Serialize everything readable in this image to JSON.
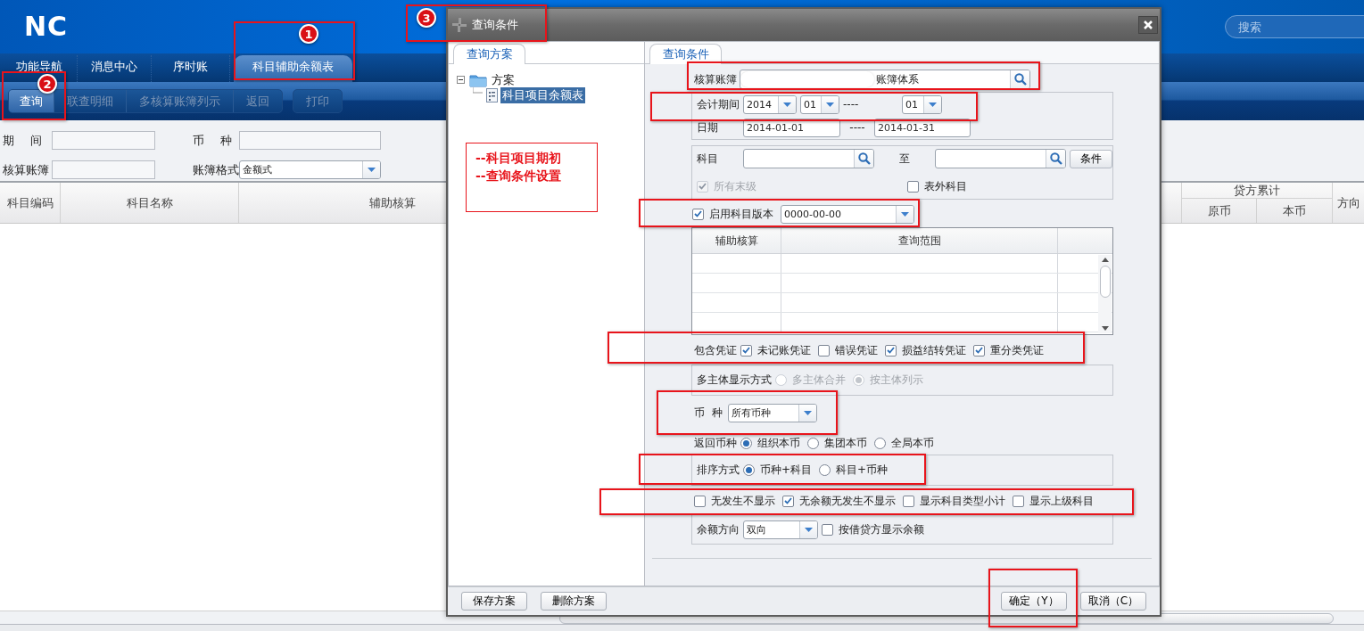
{
  "app": {
    "logo": "NC",
    "search": {
      "placeholder": "搜索"
    },
    "tabs": [
      {
        "label": "功能导航",
        "selected": false
      },
      {
        "label": "消息中心",
        "selected": false
      },
      {
        "label": "序时账",
        "selected": false
      },
      {
        "label": "科目辅助余额表",
        "selected": true
      }
    ],
    "toolbar": [
      {
        "buttons": [
          {
            "label": "查询",
            "disabled": false
          },
          {
            "label": "联查明细",
            "disabled": true
          },
          {
            "label": "多核算账簿列示",
            "disabled": true
          },
          {
            "label": "返回",
            "disabled": true
          }
        ]
      },
      {
        "buttons": [
          {
            "label": "打印",
            "disabled": true
          }
        ]
      }
    ],
    "filters": [
      {
        "label": "期 间",
        "kind": "text"
      },
      {
        "label": "币 种",
        "kind": "text"
      },
      {
        "label": "核算账簿",
        "kind": "text"
      },
      {
        "label": "账簿格式",
        "kind": "combo",
        "value": "金额式"
      }
    ],
    "table": {
      "columns": [
        "科目编码",
        "科目名称",
        "辅助核算"
      ],
      "right_columns": [
        {
          "label": "贷方累计",
          "children": [
            "原币",
            "本币"
          ]
        },
        {
          "label": "方向"
        }
      ]
    }
  },
  "dialog": {
    "title": "查询条件",
    "left": {
      "tab": "查询方案",
      "tree": [
        {
          "label": "方案",
          "expanded": true,
          "children": [
            {
              "label": "科目项目余额表",
              "selected": true
            }
          ]
        }
      ]
    },
    "right": {
      "tab": "查询条件",
      "form": [
        {
          "kind": "row",
          "items": [
            {
              "kind": "label",
              "text": "核算账簿"
            },
            {
              "kind": "lookup",
              "value": "账簿体系",
              "redacted": true
            }
          ]
        },
        {
          "kind": "group",
          "rows": [
            {
              "kind": "row",
              "items": [
                {
                  "kind": "label",
                  "text": "会计期间"
                },
                {
                  "kind": "combo",
                  "value": "2014"
                },
                {
                  "kind": "combo",
                  "value": "01"
                },
                {
                  "kind": "sep",
                  "text": "----"
                },
                {
                  "kind": "combo",
                  "value": "01"
                }
              ]
            },
            {
              "kind": "row",
              "items": [
                {
                  "kind": "label",
                  "text": "日期"
                },
                {
                  "kind": "text",
                  "value": "2014-01-01"
                },
                {
                  "kind": "sep",
                  "text": "----"
                },
                {
                  "kind": "text",
                  "value": "2014-01-31"
                }
              ]
            }
          ]
        },
        {
          "kind": "group",
          "rows": [
            {
              "kind": "row",
              "items": [
                {
                  "kind": "label",
                  "text": "科目"
                },
                {
                  "kind": "lookup"
                },
                {
                  "kind": "sep",
                  "text": "至"
                },
                {
                  "kind": "lookup"
                },
                {
                  "kind": "button",
                  "text": "条件"
                }
              ]
            },
            {
              "kind": "row",
              "items": [
                {
                  "kind": "check",
                  "label": "所有末级",
                  "checked": true,
                  "disabled": true
                },
                {
                  "kind": "check",
                  "label": "表外科目",
                  "checked": false,
                  "disabled": false
                }
              ]
            }
          ]
        },
        {
          "kind": "row",
          "items": [
            {
              "kind": "check",
              "label": "启用科目版本",
              "checked": true,
              "disabled": false
            },
            {
              "kind": "combo",
              "value": "0000-00-00"
            }
          ]
        },
        {
          "kind": "grid",
          "columns": [
            "辅助核算",
            "查询范围"
          ]
        },
        {
          "kind": "row",
          "items": [
            {
              "kind": "label",
              "text": "包含凭证"
            },
            {
              "kind": "check",
              "label": "未记账凭证",
              "checked": true,
              "disabled": false
            },
            {
              "kind": "check",
              "label": "错误凭证",
              "checked": false,
              "disabled": false
            },
            {
              "kind": "check",
              "label": "损益结转凭证",
              "checked": true,
              "disabled": false
            },
            {
              "kind": "check",
              "label": "重分类凭证",
              "checked": true,
              "disabled": false
            }
          ]
        },
        {
          "kind": "group",
          "rows": [
            {
              "kind": "row",
              "items": [
                {
                  "kind": "label",
                  "text": "多主体显示方式"
                },
                {
                  "kind": "radio",
                  "label": "多主体合并",
                  "selected": false,
                  "disabled": true
                },
                {
                  "kind": "radio",
                  "label": "按主体列示",
                  "selected": true,
                  "disabled": true
                }
              ]
            }
          ]
        },
        {
          "kind": "row",
          "items": [
            {
              "kind": "label",
              "text": "币 种"
            },
            {
              "kind": "combo",
              "value": "所有币种"
            }
          ]
        },
        {
          "kind": "row",
          "items": [
            {
              "kind": "label",
              "text": "返回币种"
            },
            {
              "kind": "radio",
              "label": "组织本币",
              "selected": true,
              "disabled": false
            },
            {
              "kind": "radio",
              "label": "集团本币",
              "selected": false,
              "disabled": false
            },
            {
              "kind": "radio",
              "label": "全局本币",
              "selected": false,
              "disabled": false
            }
          ]
        },
        {
          "kind": "group",
          "rows": [
            {
              "kind": "row",
              "items": [
                {
                  "kind": "label",
                  "text": "排序方式"
                },
                {
                  "kind": "radio",
                  "label": "币种+科目",
                  "selected": true,
                  "disabled": false
                },
                {
                  "kind": "radio",
                  "label": "科目+币种",
                  "selected": false,
                  "disabled": false
                }
              ]
            }
          ]
        },
        {
          "kind": "row",
          "items": [
            {
              "kind": "check",
              "label": "无发生不显示",
              "checked": false,
              "disabled": false
            },
            {
              "kind": "check",
              "label": "无余额无发生不显示",
              "checked": true,
              "disabled": false
            },
            {
              "kind": "check",
              "label": "显示科目类型小计",
              "checked": false,
              "disabled": false
            },
            {
              "kind": "check",
              "label": "显示上级科目",
              "checked": false,
              "disabled": false
            }
          ]
        },
        {
          "kind": "group",
          "rows": [
            {
              "kind": "row",
              "items": [
                {
                  "kind": "label",
                  "text": "余额方向"
                },
                {
                  "kind": "combo",
                  "value": "双向"
                },
                {
                  "kind": "check",
                  "label": "按借贷方显示余额",
                  "checked": false,
                  "disabled": false
                }
              ]
            }
          ]
        }
      ]
    },
    "buttons_left": [
      "保存方案",
      "删除方案"
    ],
    "buttons_right": [
      "确定（Y）",
      "取消（C）"
    ]
  },
  "annotations": {
    "markers": [
      {
        "number": "1"
      },
      {
        "number": "2"
      },
      {
        "number": "3"
      }
    ],
    "note": [
      "--科目项目期初",
      "--查询条件设置"
    ]
  }
}
